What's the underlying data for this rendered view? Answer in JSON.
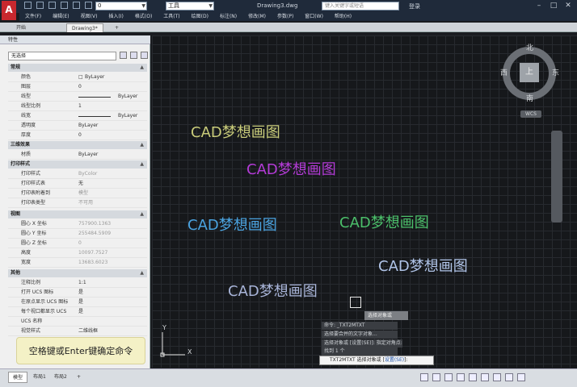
{
  "app": {
    "logo_letter": "A",
    "document_title": "Drawing3.dwg",
    "search_placeholder": "键入关键字或短语",
    "user_label": "登录",
    "layer_combo_value": "0",
    "workspace_combo_value": "工具",
    "window_buttons": {
      "minimize": "–",
      "maximize": "□",
      "close": "✕"
    }
  },
  "menu": [
    "文件(F)",
    "编辑(E)",
    "视图(V)",
    "插入(I)",
    "格式(O)",
    "工具(T)",
    "绘图(D)",
    "标注(N)",
    "修改(M)",
    "参数(P)",
    "窗口(W)",
    "帮助(H)"
  ],
  "tabs": {
    "start": "开始",
    "drawing": "Drawing3*",
    "add": "+"
  },
  "properties": {
    "title": "特性",
    "selection": "无选择",
    "sections": {
      "general": {
        "title": "常规",
        "rows": [
          {
            "key": "颜色",
            "value": "ByLayer"
          },
          {
            "key": "图层",
            "value": "0"
          },
          {
            "key": "线型",
            "value": "ByLayer"
          },
          {
            "key": "线型比例",
            "value": "1"
          },
          {
            "key": "线宽",
            "value": "ByLayer"
          },
          {
            "key": "透明度",
            "value": "ByLayer"
          },
          {
            "key": "厚度",
            "value": "0"
          }
        ]
      },
      "3d": {
        "title": "三维效果",
        "rows": [
          {
            "key": "材质",
            "value": "ByLayer"
          }
        ]
      },
      "plot": {
        "title": "打印样式",
        "rows": [
          {
            "key": "打印样式",
            "value": "ByColor"
          },
          {
            "key": "打印样式表",
            "value": "无"
          },
          {
            "key": "打印表附着到",
            "value": "模型"
          },
          {
            "key": "打印表类型",
            "value": "不可用"
          }
        ]
      },
      "view": {
        "title": "视图",
        "rows": [
          {
            "key": "圆心 X 坐标",
            "value": "757900.1363"
          },
          {
            "key": "圆心 Y 坐标",
            "value": "255484.5909"
          },
          {
            "key": "圆心 Z 坐标",
            "value": "0"
          },
          {
            "key": "高度",
            "value": "10097.7527"
          },
          {
            "key": "宽度",
            "value": "13683.6023"
          }
        ]
      },
      "misc": {
        "title": "其他",
        "rows": [
          {
            "key": "注释比例",
            "value": "1:1"
          },
          {
            "key": "打开 UCS 图标",
            "value": "是"
          },
          {
            "key": "在原点显示 UCS 图标",
            "value": "是"
          },
          {
            "key": "每个视口都显示 UCS",
            "value": "是"
          },
          {
            "key": "UCS 名称",
            "value": ""
          },
          {
            "key": "视觉样式",
            "value": "二维线框"
          }
        ]
      }
    }
  },
  "canvas": {
    "texts": [
      {
        "text": "CAD梦想画图",
        "color": "#c9cc7a"
      },
      {
        "text": "CAD梦想画图",
        "color": "#b33bd6"
      },
      {
        "text": "CAD梦想画图",
        "color": "#4aa3e0"
      },
      {
        "text": "CAD梦想画图",
        "color": "#4bbf6a"
      },
      {
        "text": "CAD梦想画图",
        "color": "#b0c4e8"
      },
      {
        "text": "CAD梦想画图",
        "color": "#a8b4d8"
      }
    ],
    "viewcube": {
      "north": "北",
      "south": "南",
      "east": "东",
      "west": "西",
      "top": "上",
      "wcs": "WCS"
    },
    "ucs": {
      "x": "X",
      "y": "Y"
    }
  },
  "command": {
    "tooltip": "选择对象或",
    "history": [
      "命令: _TXT2MTXT",
      "选择要合并的文字对象...",
      "选择对象或 [设置(SE)]: 指定对角点:",
      "找到 1 个"
    ],
    "prompt": "TXT2MTXT 选择对象或 [",
    "option": "设置(SE)",
    "prompt_end": "]:"
  },
  "hint": "空格键或Enter键确定命令",
  "status_tabs": {
    "model": "模型",
    "layout1": "布局1",
    "layout2": "布局2",
    "add": "+"
  }
}
